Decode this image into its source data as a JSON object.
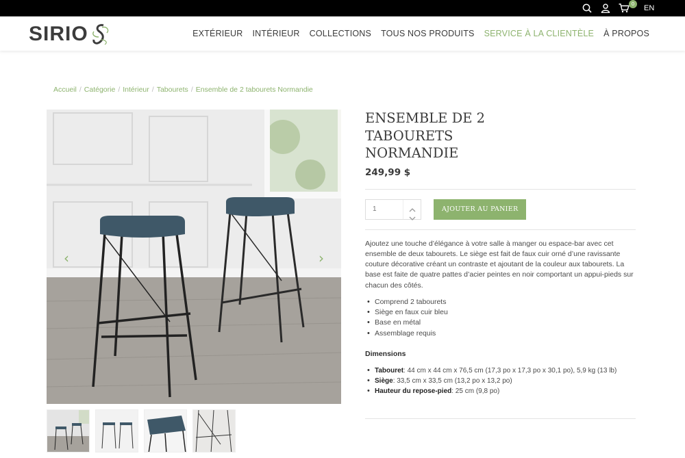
{
  "topbar": {
    "icons": [
      "search-icon",
      "user-icon",
      "cart-icon"
    ],
    "cart_count": "0",
    "language": "EN"
  },
  "header": {
    "logo": "SIRIO",
    "nav": [
      {
        "label": "EXTÉRIEUR"
      },
      {
        "label": "INTÉRIEUR"
      },
      {
        "label": "COLLECTIONS"
      },
      {
        "label": "TOUS NOS PRODUITS"
      },
      {
        "label": "SERVICE À LA CLIENTÈLE"
      },
      {
        "label": "À PROPOS"
      }
    ]
  },
  "breadcrumb": [
    "Accueil",
    "Catégorie",
    "Intérieur",
    "Tabourets",
    "Ensemble de 2 tabourets Normandie"
  ],
  "product": {
    "title": "ENSEMBLE DE 2 TABOURETS NORMANDIE",
    "price": "249,99 $",
    "quantity_value": "1",
    "add_to_cart": "AJOUTER AU PANIER",
    "description": "Ajoutez une touche d’élégance à votre salle à manger ou espace-bar avec cet ensemble de deux tabourets. Le siège est fait de faux cuir orné d’une ravissante couture décorative créant un contraste et ajoutant de la couleur aux tabourets. La base est faite de quatre pattes d’acier peintes en noir comportant un appui-pieds sur chacun des côtés.",
    "features": [
      "Comprend 2 tabourets",
      "Siège en faux cuir bleu",
      "Base en métal",
      "Assemblage requis"
    ],
    "dimensions_heading": "Dimensions",
    "dimensions": [
      {
        "label": "Tabouret",
        "value": ": 44 cm x 44 cm x 76,5 cm (17,3 po x 17,3 po x 30,1 po), 5,9 kg (13 lb)"
      },
      {
        "label": "Siège",
        "value": ": 33,5 cm x 33,5 cm (13,2 po x 13,2 po)"
      },
      {
        "label": "Hauteur du repose-pied",
        "value": ": 25 cm (9,8 po)"
      }
    ]
  },
  "colors": {
    "accent": "#8db36e",
    "topbar": "#000000",
    "text": "#3a3a3a",
    "seat": "#3f5868"
  }
}
